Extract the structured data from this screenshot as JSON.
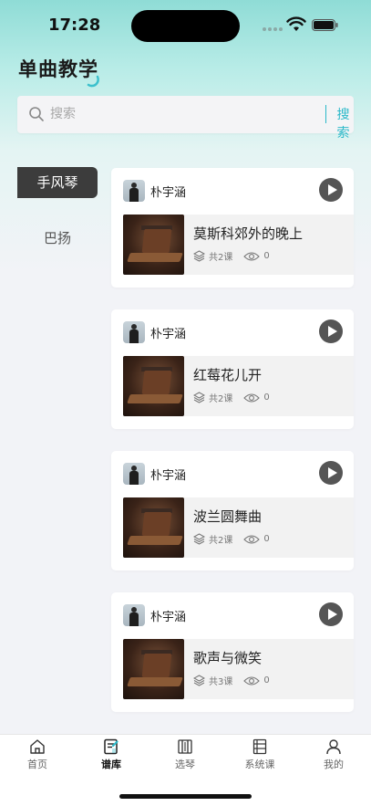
{
  "status_bar": {
    "time": "17:28"
  },
  "header": {
    "title": "单曲教学"
  },
  "search": {
    "placeholder": "搜索",
    "button_label": "搜索"
  },
  "sidebar": {
    "items": [
      {
        "label": "手风琴",
        "active": true
      },
      {
        "label": "巴扬",
        "active": false
      }
    ]
  },
  "songs": [
    {
      "author": "朴宇涵",
      "title": "莫斯科郊外的晚上",
      "lessons": "共2课",
      "views": "0"
    },
    {
      "author": "朴宇涵",
      "title": "红莓花儿开",
      "lessons": "共2课",
      "views": "0"
    },
    {
      "author": "朴宇涵",
      "title": "波兰圆舞曲",
      "lessons": "共2课",
      "views": "0"
    },
    {
      "author": "朴宇涵",
      "title": "歌声与微笑",
      "lessons": "共3课",
      "views": "0"
    }
  ],
  "tab_bar": {
    "tabs": [
      {
        "label": "首页",
        "icon": "home-icon"
      },
      {
        "label": "谱库",
        "icon": "score-library-icon"
      },
      {
        "label": "选琴",
        "icon": "accordion-icon"
      },
      {
        "label": "系统课",
        "icon": "course-list-icon"
      },
      {
        "label": "我的",
        "icon": "profile-icon"
      }
    ],
    "active_index": 1
  },
  "colors": {
    "accent": "#2bb9c9",
    "active_side": "#3c3c3c"
  }
}
